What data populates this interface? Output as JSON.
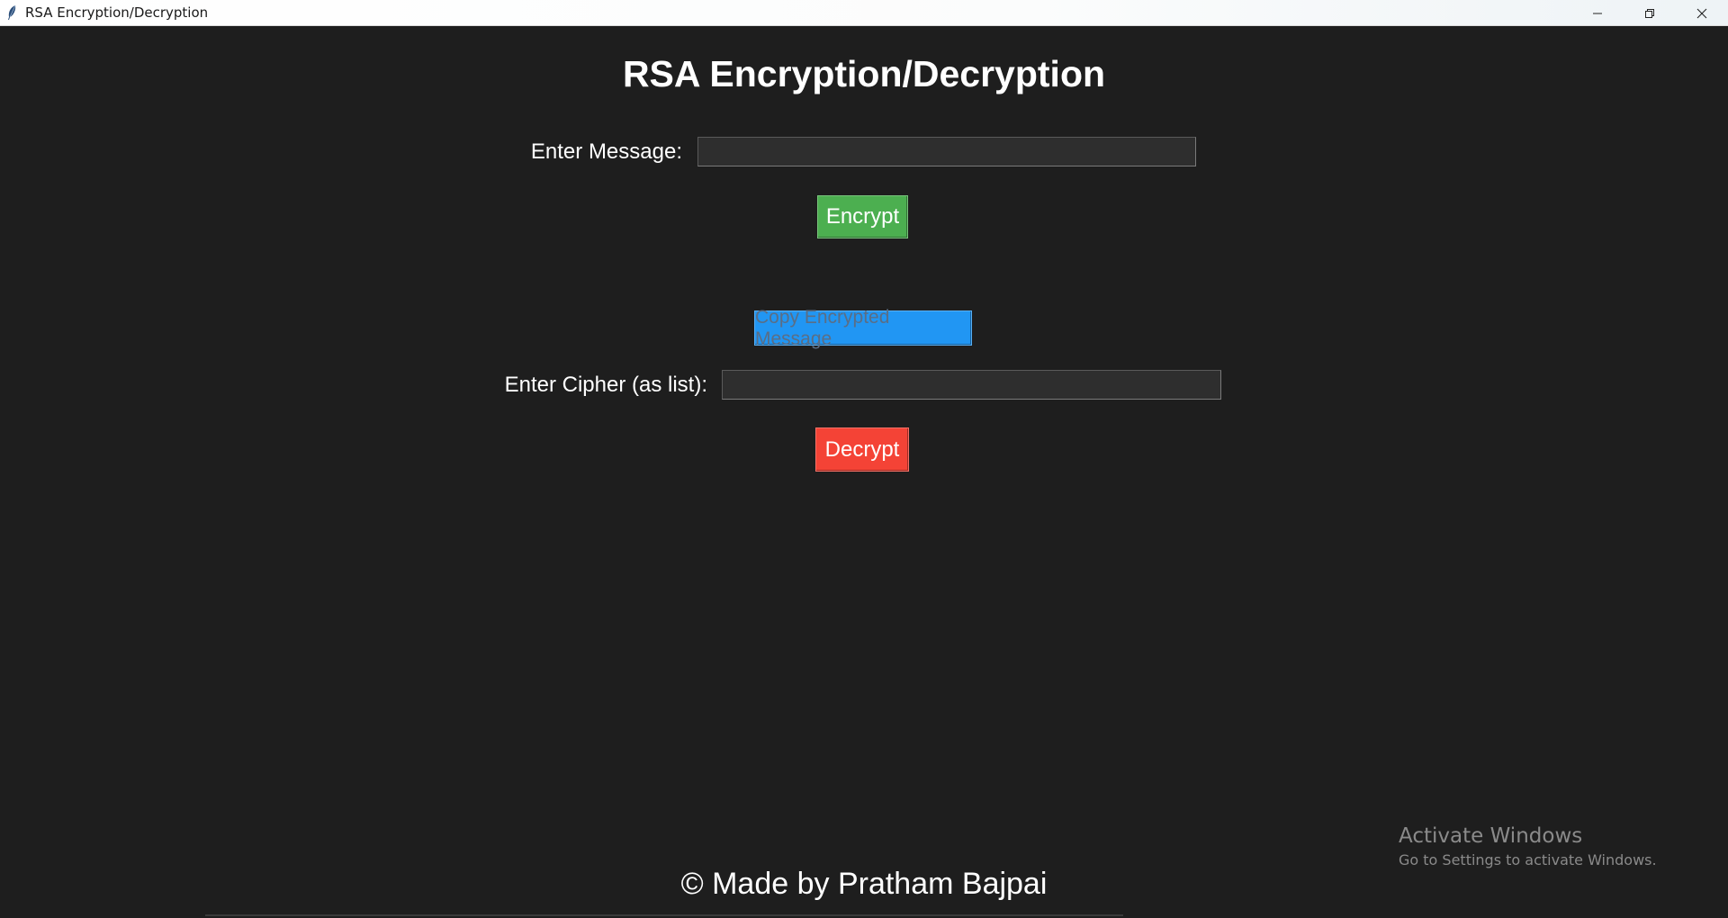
{
  "window": {
    "title": "RSA Encryption/Decryption",
    "controls": [
      "minimize-icon",
      "restore-icon",
      "close-icon"
    ]
  },
  "app": {
    "heading": "RSA Encryption/Decryption",
    "message_label": "Enter Message:",
    "message_value": "",
    "encrypt_label": "Encrypt",
    "copy_label": "Copy Encrypted Message",
    "cipher_label": "Enter Cipher (as list):",
    "cipher_value": "",
    "decrypt_label": "Decrypt",
    "footer": "© Made by Pratham Bajpai"
  },
  "watermark": {
    "title": "Activate Windows",
    "subtitle": "Go to Settings to activate Windows."
  },
  "colors": {
    "background": "#1e1e1e",
    "encrypt": "#4caf50",
    "copy": "#2196f3",
    "decrypt": "#f44336"
  }
}
